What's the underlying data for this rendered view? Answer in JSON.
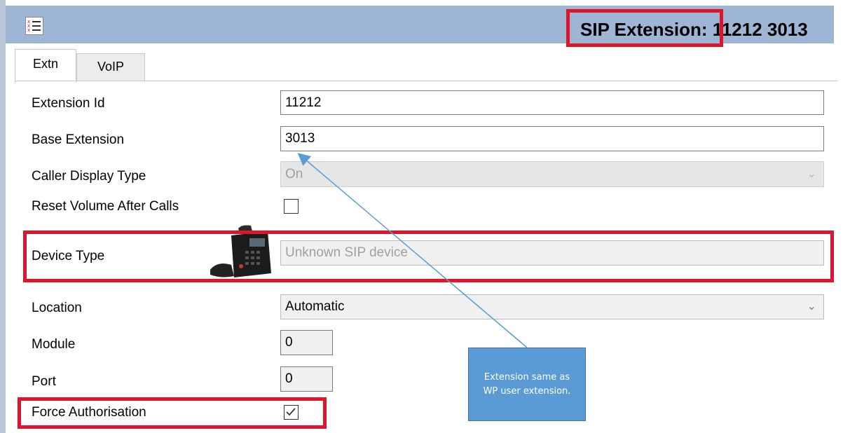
{
  "window": {
    "title": "SIP Extension: 11212 3013"
  },
  "tabs": [
    {
      "label": "Extn",
      "active": true
    },
    {
      "label": "VoIP",
      "active": false
    }
  ],
  "form": {
    "extension_id": {
      "label": "Extension Id",
      "value": "11212"
    },
    "base_extension": {
      "label": "Base Extension",
      "value": "3013"
    },
    "caller_display_type": {
      "label": "Caller Display Type",
      "value": "On"
    },
    "reset_volume": {
      "label": "Reset Volume After Calls",
      "checked": false
    },
    "device_type": {
      "label": "Device Type",
      "value": "Unknown SIP device",
      "icon": "desk-phone-icon"
    },
    "location": {
      "label": "Location",
      "value": "Automatic"
    },
    "module": {
      "label": "Module",
      "value": "0"
    },
    "port": {
      "label": "Port",
      "value": "0"
    },
    "force_authorisation": {
      "label": "Force Authorisation",
      "checked": true
    }
  },
  "annotation": {
    "callout_line1": "Extension same as",
    "callout_line2": "WP user extension.",
    "highlight_color": "#e0142a",
    "callout_color": "#5b9bd5"
  }
}
